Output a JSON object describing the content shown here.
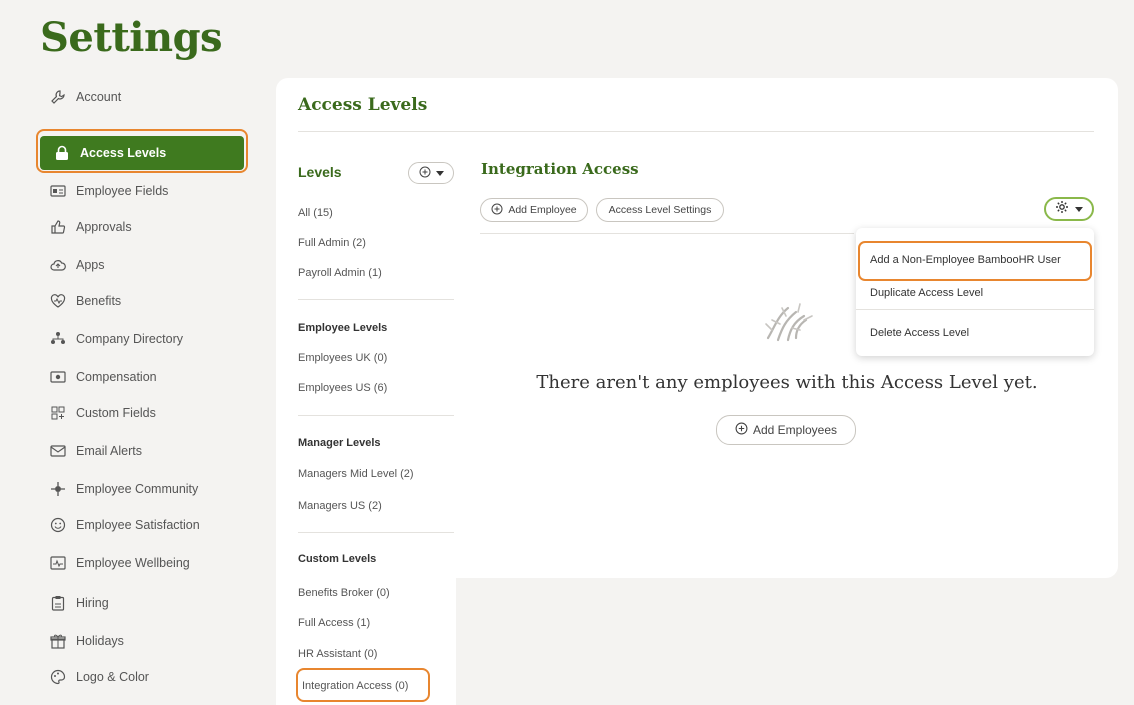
{
  "page": {
    "title": "Settings"
  },
  "sidebar": {
    "items": [
      {
        "label": "Account",
        "icon": "wrench-icon"
      },
      {
        "label": "Access Levels",
        "icon": "lock-icon",
        "active": true
      },
      {
        "label": "Employee Fields",
        "icon": "id-card-icon"
      },
      {
        "label": "Approvals",
        "icon": "thumbs-up-icon"
      },
      {
        "label": "Apps",
        "icon": "cloud-icon"
      },
      {
        "label": "Benefits",
        "icon": "heart-icon"
      },
      {
        "label": "Company Directory",
        "icon": "org-chart-icon"
      },
      {
        "label": "Compensation",
        "icon": "money-icon"
      },
      {
        "label": "Custom Fields",
        "icon": "fields-icon"
      },
      {
        "label": "Email Alerts",
        "icon": "mail-icon"
      },
      {
        "label": "Employee Community",
        "icon": "community-icon"
      },
      {
        "label": "Employee Satisfaction",
        "icon": "smile-icon"
      },
      {
        "label": "Employee Wellbeing",
        "icon": "wellbeing-icon"
      },
      {
        "label": "Hiring",
        "icon": "clipboard-icon"
      },
      {
        "label": "Holidays",
        "icon": "gift-icon"
      },
      {
        "label": "Logo & Color",
        "icon": "palette-icon"
      }
    ]
  },
  "main": {
    "title": "Access Levels",
    "levels": {
      "heading": "Levels",
      "top": [
        "All (15)",
        "Full Admin (2)",
        "Payroll Admin (1)"
      ],
      "employee_heading": "Employee Levels",
      "employee": [
        "Employees UK (0)",
        "Employees US (6)"
      ],
      "manager_heading": "Manager Levels",
      "manager": [
        "Managers Mid Level (2)",
        "Managers US (2)"
      ],
      "custom_heading": "Custom Levels",
      "custom": [
        "Benefits Broker (0)",
        "Full Access (1)",
        "HR Assistant (0)",
        "Integration Access (0)"
      ]
    },
    "detail": {
      "title": "Integration Access",
      "add_employee": "Add Employee",
      "settings": "Access Level Settings",
      "menu": [
        "Add a Non-Employee BambooHR User",
        "Duplicate Access Level",
        "Delete Access Level"
      ],
      "empty_message": "There aren't any employees with this Access Level yet.",
      "add_employees": "Add Employees"
    }
  },
  "colors": {
    "brand": "#3a6a1c",
    "active_bg": "#3f7a1f",
    "highlight": "#e8862f"
  }
}
